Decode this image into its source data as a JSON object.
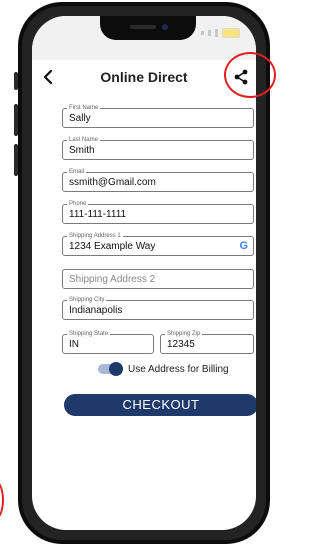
{
  "nav": {
    "title": "Online Direct"
  },
  "form": {
    "first_name": {
      "label": "First Name",
      "value": "Sally"
    },
    "last_name": {
      "label": "Last Name",
      "value": "Smith"
    },
    "email": {
      "label": "Email",
      "value": "ssmith@Gmail.com"
    },
    "phone": {
      "label": "Phone",
      "value": "111-111-1111"
    },
    "address1": {
      "label": "Shipping Address 1",
      "value": "1234 Example Way"
    },
    "address2": {
      "placeholder": "Shipping Address 2"
    },
    "city": {
      "label": "Shipping City",
      "value": "Indianapolis"
    },
    "state": {
      "label": "Shipping State",
      "value": "IN"
    },
    "zip": {
      "label": "Shipping Zip",
      "value": "12345"
    }
  },
  "billing_toggle": {
    "label": "Use Address for Billing",
    "on": true
  },
  "checkout": {
    "label": "CHECKOUT"
  },
  "icons": {
    "back": "chevron-left-icon",
    "share": "share-icon",
    "google": "google-g-icon"
  },
  "colors": {
    "primary": "#1f3a6a",
    "highlight": "#e02020",
    "google_blue": "#4285f4"
  }
}
